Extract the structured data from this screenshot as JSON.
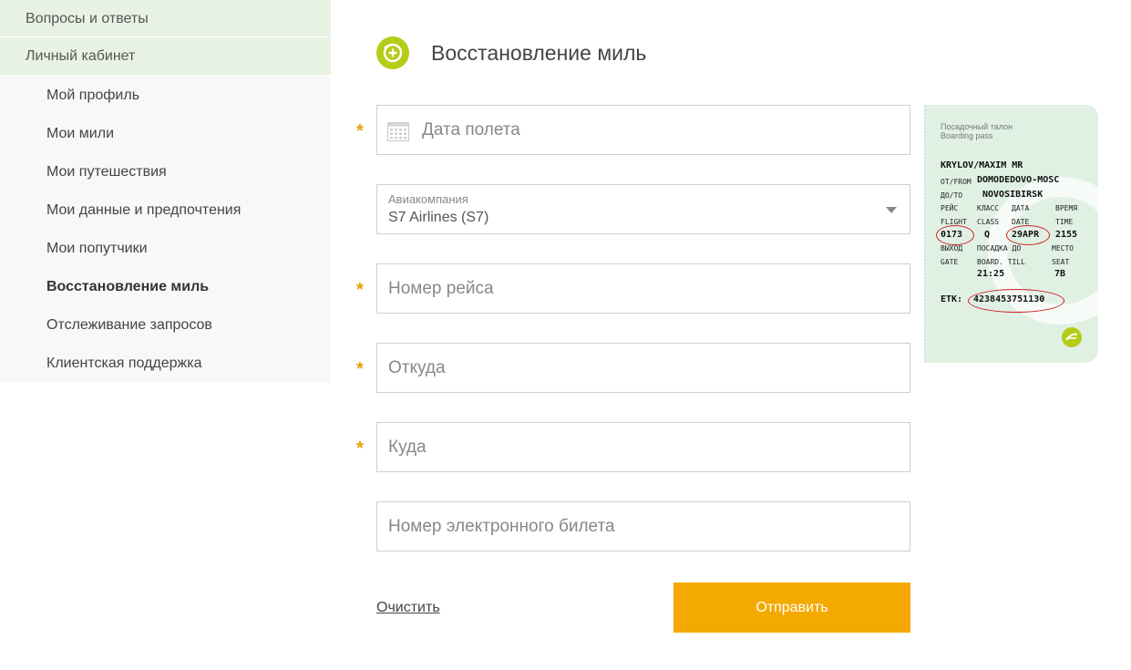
{
  "sidebar": {
    "top_items": [
      {
        "label": "Вопросы и ответы"
      },
      {
        "label": "Личный кабинет"
      }
    ],
    "sub_items": [
      {
        "label": "Мой профиль"
      },
      {
        "label": "Мои мили"
      },
      {
        "label": "Мои путешествия"
      },
      {
        "label": "Мои данные и предпочтения"
      },
      {
        "label": "Мои попутчики"
      },
      {
        "label": "Восстановление миль"
      },
      {
        "label": "Отслеживание запросов"
      },
      {
        "label": "Клиентская поддержка"
      }
    ],
    "active_item": "Восстановление миль"
  },
  "header": {
    "icon": "add-circle-icon",
    "title": "Восстановление миль"
  },
  "form": {
    "required_mark": "*",
    "date": {
      "placeholder": "Дата полета",
      "icon": "calendar-icon",
      "value": ""
    },
    "airline": {
      "label": "Авиакомпания",
      "value": "S7 Airlines (S7)"
    },
    "flight_number": {
      "placeholder": "Номер рейса",
      "value": ""
    },
    "from": {
      "placeholder": "Откуда",
      "value": ""
    },
    "to": {
      "placeholder": "Куда",
      "value": ""
    },
    "ticket_number": {
      "placeholder": "Номер электронного билета",
      "value": ""
    },
    "clear_label": "Очистить",
    "submit_label": "Отправить"
  },
  "boarding_pass": {
    "title_ru": "Посадочный талон",
    "title_en": "Boarding pass",
    "passenger": "KRYLOV/MAXIM MR",
    "from_label": "ОТ/FROM",
    "from_value": "DOMODEDOVO-MOSC",
    "to_label": "ДО/TO",
    "to_value": "NOVOSIBIRSK",
    "flight_label_ru": "РЕЙС",
    "flight_label_en": "FLIGHT",
    "class_label_ru": "КЛАСС",
    "class_label_en": "CLASS",
    "date_label_ru": "ДАТА",
    "date_label_en": "DATE",
    "time_label_ru": "ВРЕМЯ",
    "time_label_en": "TIME",
    "flight": "0173",
    "class": "Q",
    "date": "29APR",
    "time": "2155",
    "gate_label_ru": "ВЫХОД",
    "gate_label_en": "GATE",
    "board_label_ru": "ПОСАДКА ДО",
    "board_label_en": "BOARD. TILL",
    "seat_label_ru": "МЕСТО",
    "seat_label_en": "SEAT",
    "board_till": "21:25",
    "seat": "7B",
    "etk_label": "ETK:",
    "etk": "4238453751130",
    "highlight_color": "#d02020",
    "background_color": "#e0f1e4"
  },
  "colors": {
    "accent_green": "#b5cc18",
    "submit_orange": "#f4a900",
    "required_star": "#e5a000",
    "sidebar_top_bg": "#e8f2e3"
  }
}
